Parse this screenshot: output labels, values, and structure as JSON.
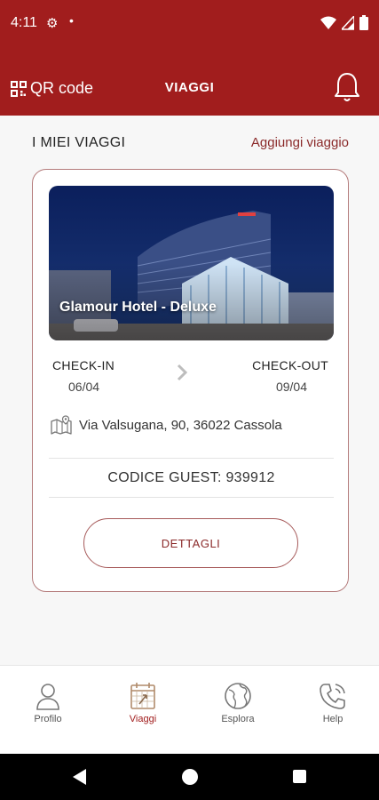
{
  "status_bar": {
    "time": "4:11"
  },
  "app_bar": {
    "qr_label": "QR code",
    "title": "VIAGGI"
  },
  "section": {
    "title": "I MIEI VIAGGI",
    "add_link": "Aggiungi viaggio"
  },
  "trip": {
    "hotel_name": "Glamour Hotel - Deluxe",
    "checkin_label": "CHECK-IN",
    "checkin_date": "06/04",
    "checkout_label": "CHECK-OUT",
    "checkout_date": "09/04",
    "address": "Via Valsugana, 90, 36022 Cassola",
    "guest_code": "CODICE GUEST: 939912",
    "details_button": "DETTAGLI"
  },
  "tabs": [
    {
      "label": "Profilo",
      "icon": "user-icon"
    },
    {
      "label": "Viaggi",
      "icon": "calendar-icon",
      "active": true
    },
    {
      "label": "Esplora",
      "icon": "globe-icon"
    },
    {
      "label": "Help",
      "icon": "phone-icon"
    }
  ],
  "colors": {
    "brand": "#a11d1d",
    "accent_text": "#8b2a2a",
    "card_border": "#b47b7b"
  }
}
